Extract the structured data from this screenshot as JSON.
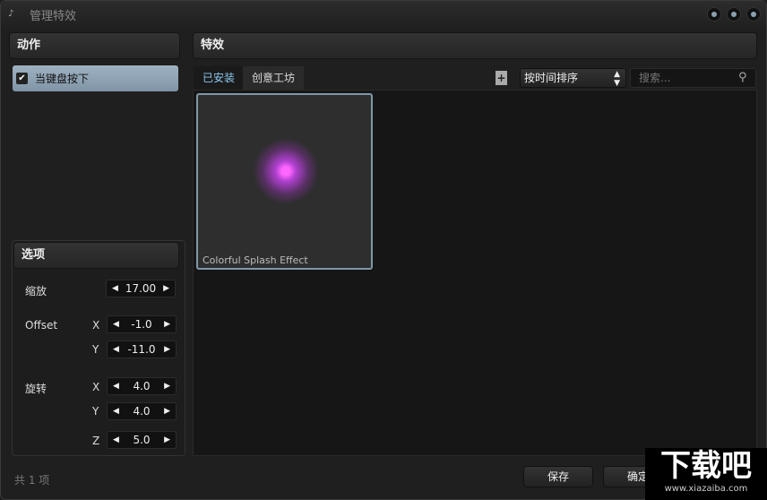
{
  "window": {
    "title": "管理特效",
    "buttons": [
      "minimize",
      "maximize",
      "close"
    ]
  },
  "left": {
    "actions_header": "动作",
    "actions": [
      {
        "label": "当键盘按下",
        "checked": true
      }
    ],
    "options_header": "选项",
    "options": {
      "scale_label": "缩放",
      "scale": "17.00",
      "offset_label": "Offset",
      "offset_x": "-1.0",
      "offset_y": "-11.0",
      "rotate_label": "旋转",
      "rot_x": "4.0",
      "rot_y": "4.0",
      "rot_z": "5.0",
      "x": "X",
      "y": "Y",
      "z": "Z"
    },
    "count": "共 1 项"
  },
  "right": {
    "header": "特效",
    "tabs": [
      "已安装",
      "创意工坊"
    ],
    "sort": "按时间排序",
    "search_placeholder": "搜索...",
    "effects": [
      {
        "name": "Colorful Splash Effect"
      }
    ]
  },
  "footer": {
    "save": "保存",
    "ok": "确定"
  },
  "watermark": {
    "text": "下载吧",
    "url": "www.xiazaiba.com"
  },
  "colors": {
    "accent": "#8cc8ee",
    "selection": "#9fb2c2"
  }
}
